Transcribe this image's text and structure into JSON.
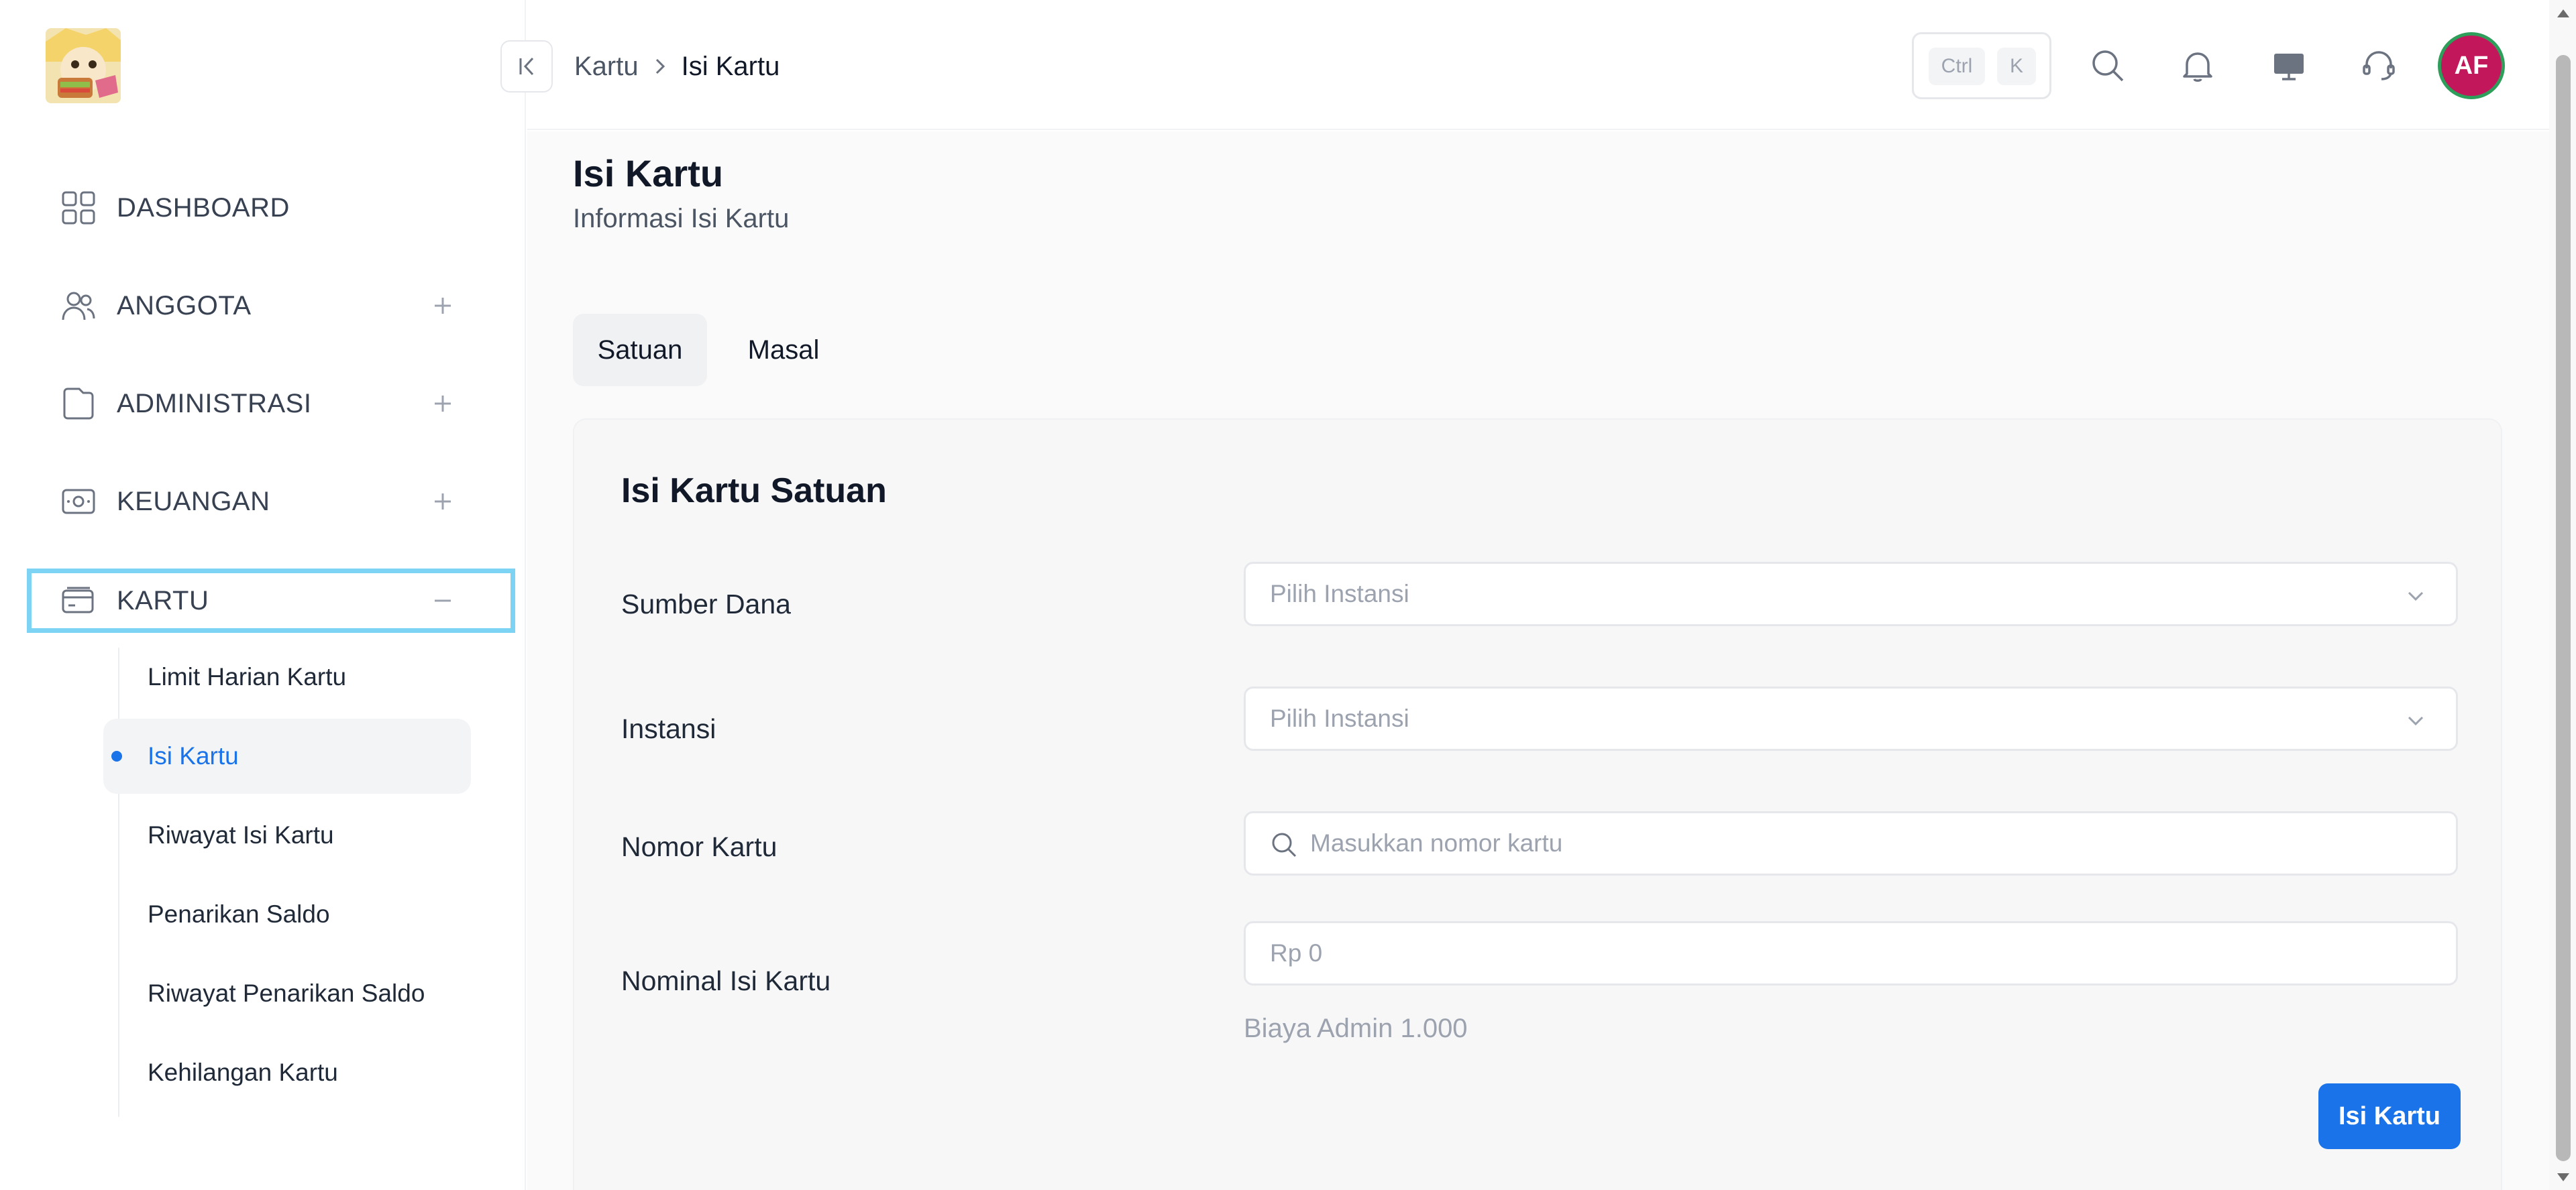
{
  "breadcrumb": {
    "parent": "Kartu",
    "current": "Isi Kartu"
  },
  "header": {
    "kbd_ctrl": "Ctrl",
    "kbd_k": "K",
    "avatar_initials": "AF"
  },
  "colors": {
    "primary": "#1a73e8",
    "active_outline": "#7dd3f4",
    "avatar_bg": "#c2185b",
    "avatar_ring": "#2e9e5b"
  },
  "sidebar": {
    "items": [
      {
        "label": "DASHBOARD",
        "icon": "grid-icon"
      },
      {
        "label": "ANGGOTA",
        "icon": "users-icon"
      },
      {
        "label": "ADMINISTRASI",
        "icon": "folder-icon"
      },
      {
        "label": "KEUANGAN",
        "icon": "wallet-icon"
      },
      {
        "label": "KARTU",
        "icon": "credit-card-icon"
      }
    ],
    "submenu": [
      {
        "label": "Limit Harian Kartu"
      },
      {
        "label": "Isi Kartu"
      },
      {
        "label": "Riwayat Isi Kartu"
      },
      {
        "label": "Penarikan Saldo"
      },
      {
        "label": "Riwayat Penarikan Saldo"
      },
      {
        "label": "Kehilangan Kartu"
      }
    ]
  },
  "page": {
    "title": "Isi Kartu",
    "subtitle": "Informasi Isi Kartu"
  },
  "tabs": [
    {
      "label": "Satuan"
    },
    {
      "label": "Masal"
    }
  ],
  "form": {
    "title": "Isi Kartu Satuan",
    "sumber_dana": {
      "label": "Sumber Dana",
      "placeholder": "Pilih Instansi"
    },
    "instansi": {
      "label": "Instansi",
      "placeholder": "Pilih Instansi"
    },
    "nomor_kartu": {
      "label": "Nomor Kartu",
      "placeholder": "Masukkan nomor kartu"
    },
    "nominal": {
      "label": "Nominal Isi Kartu",
      "placeholder": "Rp 0",
      "helper": "Biaya Admin 1.000"
    },
    "submit_label": "Isi Kartu"
  }
}
